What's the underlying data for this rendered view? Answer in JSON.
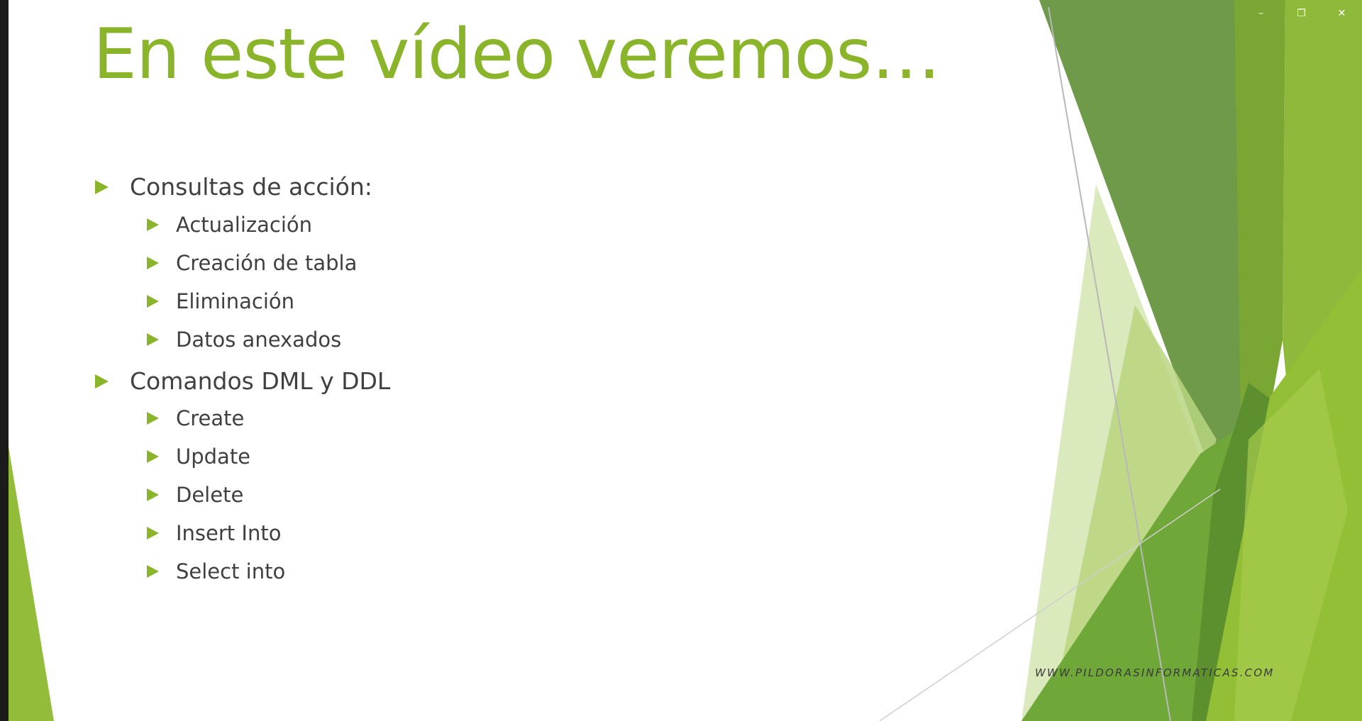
{
  "slide": {
    "title": "En este vídeo veremos…",
    "bullets": [
      {
        "text": "Consultas de acción:",
        "level": 1
      },
      {
        "text": "Actualización",
        "level": 2
      },
      {
        "text": "Creación de tabla",
        "level": 2
      },
      {
        "text": "Eliminación",
        "level": 2
      },
      {
        "text": "Datos anexados",
        "level": 2
      },
      {
        "text": "Comandos DML y DDL",
        "level": 1
      },
      {
        "text": "Create",
        "level": 2
      },
      {
        "text": "Update",
        "level": 2
      },
      {
        "text": "Delete",
        "level": 2
      },
      {
        "text": "Insert Into",
        "level": 2
      },
      {
        "text": "Select into",
        "level": 2
      }
    ],
    "watermark": "WWW.PILDORASINFORMATICAS.COM",
    "colors": {
      "accent": "#8ab52a",
      "text": "#404040",
      "dark_green": "#5e8a3f",
      "light_green": "#c8dea0"
    },
    "bullet_icon": "triangle-right-icon"
  },
  "window_controls": {
    "minimize": "–",
    "restore": "❐",
    "close": "✕"
  }
}
